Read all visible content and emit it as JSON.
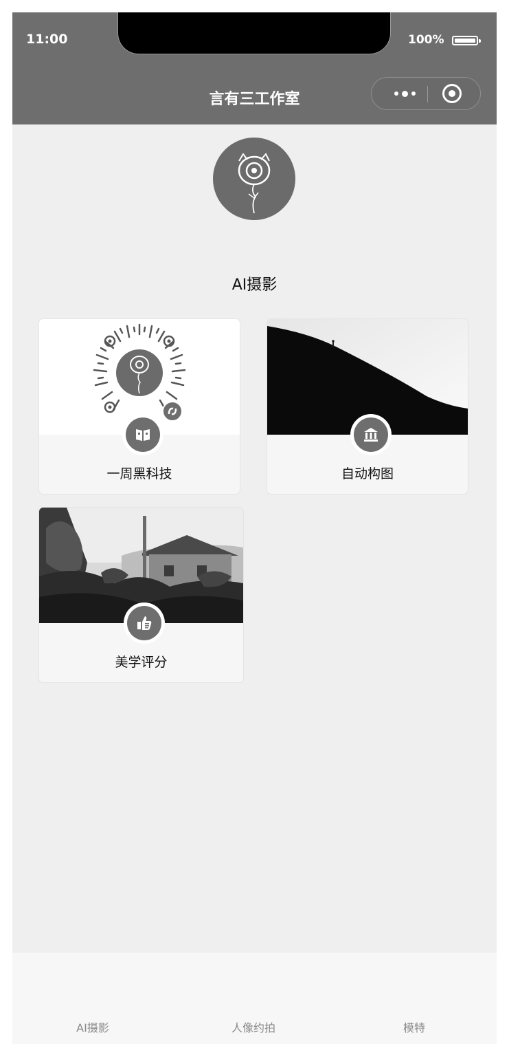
{
  "status_bar": {
    "time": "11:00",
    "battery": "100%"
  },
  "nav": {
    "title": "言有三工作室"
  },
  "section": {
    "title": "AI摄影"
  },
  "cards": [
    {
      "label": "一周黑科技",
      "icon": "book-icon"
    },
    {
      "label": "自动构图",
      "icon": "bank-icon"
    },
    {
      "label": "美学评分",
      "icon": "thumbs-up-icon"
    }
  ],
  "tabbar": {
    "items": [
      {
        "label": "AI摄影"
      },
      {
        "label": "人像约拍"
      },
      {
        "label": "模特"
      }
    ]
  }
}
